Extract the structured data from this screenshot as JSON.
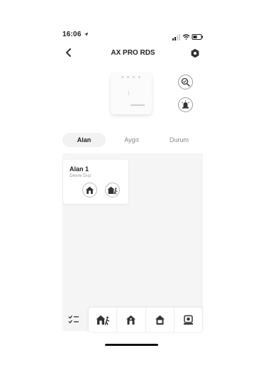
{
  "status_bar": {
    "time": "16:06"
  },
  "header": {
    "title": "AX PRO RDS"
  },
  "device": {
    "name": "AX PRO hub"
  },
  "tabs": [
    {
      "label": "Alan",
      "active": true
    },
    {
      "label": "Aygıt",
      "active": false
    },
    {
      "label": "Durum",
      "active": false
    }
  ],
  "areas": [
    {
      "name": "Alan 1",
      "status": "Devre Dışı"
    }
  ],
  "actions": [
    "away-arm",
    "stay-arm",
    "disarm",
    "clear-alarm"
  ],
  "colors": {
    "icon": "#3a3a3a",
    "content_bg": "#f5f5f5"
  }
}
